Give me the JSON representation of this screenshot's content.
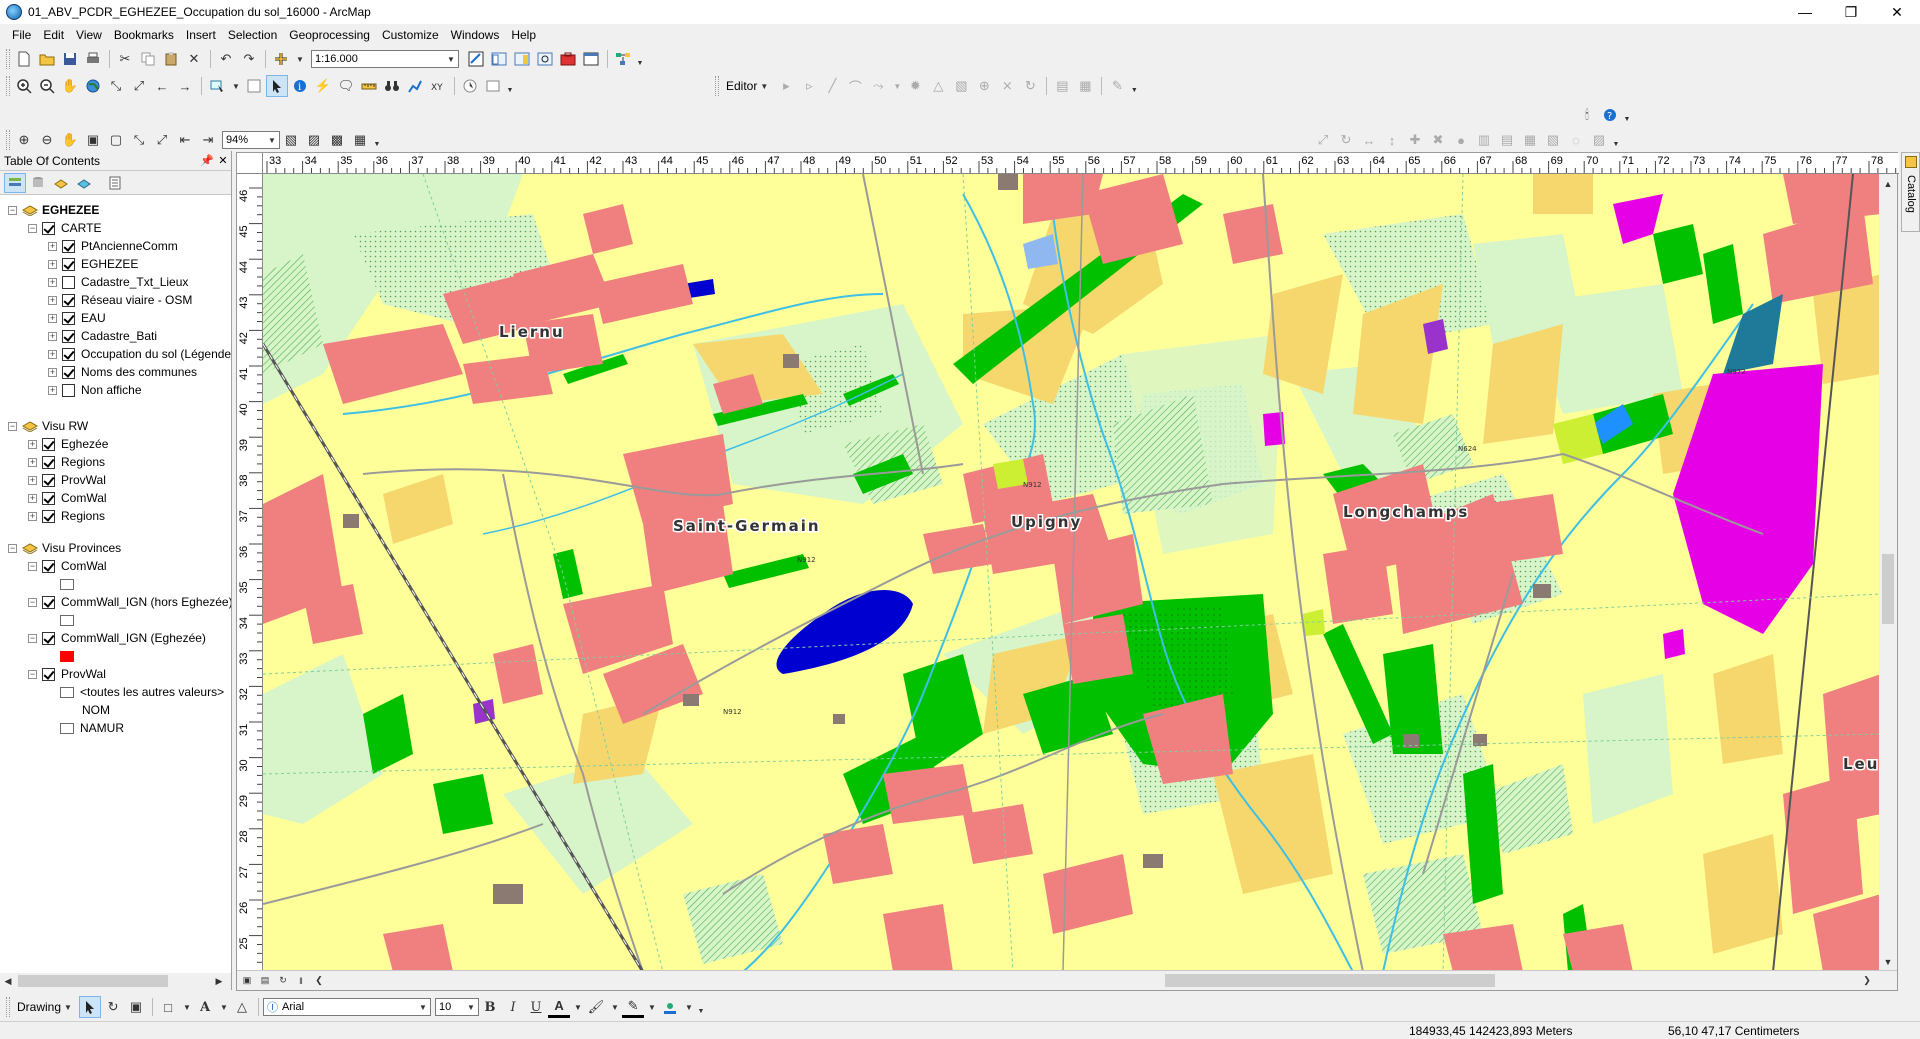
{
  "window": {
    "title": "01_ABV_PCDR_EGHEZEE_Occupation du sol_16000 - ArcMap"
  },
  "menu": [
    "File",
    "Edit",
    "View",
    "Bookmarks",
    "Insert",
    "Selection",
    "Geoprocessing",
    "Customize",
    "Windows",
    "Help"
  ],
  "toolbar": {
    "scale": "1:16.000",
    "editor_label": "Editor",
    "zoom_percent": "94%"
  },
  "toc": {
    "title": "Table Of Contents",
    "groups": [
      {
        "label": "EGHEZEE",
        "bold": true,
        "expanded": true
      },
      {
        "label": "CARTE",
        "checked": true
      },
      {
        "label": "PtAncienneComm",
        "checked": true
      },
      {
        "label": "EGHEZEE",
        "checked": true
      },
      {
        "label": "Cadastre_Txt_Lieux",
        "checked": false
      },
      {
        "label": "Réseau viaire - OSM",
        "checked": true
      },
      {
        "label": "EAU",
        "checked": true
      },
      {
        "label": "Cadastre_Bati",
        "checked": true
      },
      {
        "label": "Occupation du sol (Légende",
        "checked": true
      },
      {
        "label": "Noms des communes",
        "checked": true
      },
      {
        "label": "Non affiche",
        "checked": false
      },
      {
        "label": "Visu RW"
      },
      {
        "label": "Eghezée",
        "checked": true
      },
      {
        "label": "Regions",
        "checked": true
      },
      {
        "label": "ProvWal",
        "checked": true
      },
      {
        "label": "ComWal",
        "checked": true
      },
      {
        "label": "Regions",
        "checked": true
      },
      {
        "label": "Visu Provinces"
      },
      {
        "label": "ComWal",
        "checked": true
      },
      {
        "label": "CommWall_IGN (hors Eghezée)",
        "checked": true
      },
      {
        "label": "CommWall_IGN (Eghezée)",
        "checked": true,
        "swatch": "#ff0000"
      },
      {
        "label": "ProvWal",
        "checked": true
      },
      {
        "label": "<toutes les autres valeurs>"
      },
      {
        "label": "NOM"
      },
      {
        "label": "NAMUR"
      }
    ]
  },
  "ruler_top": [
    "33",
    "34",
    "35",
    "36",
    "37",
    "38",
    "39",
    "40",
    "41",
    "42",
    "43",
    "44",
    "45",
    "46",
    "47",
    "48",
    "49",
    "50",
    "51",
    "52",
    "53",
    "54",
    "55",
    "56",
    "57",
    "58",
    "59",
    "60",
    "61",
    "62",
    "63",
    "64",
    "65",
    "66",
    "67",
    "68",
    "69",
    "70",
    "71",
    "72",
    "73",
    "74",
    "75",
    "76",
    "77",
    "78"
  ],
  "ruler_left": [
    "46",
    "45",
    "44",
    "43",
    "42",
    "41",
    "40",
    "39",
    "38",
    "37",
    "36",
    "35",
    "34",
    "33",
    "32",
    "31",
    "30",
    "29",
    "28",
    "27",
    "26",
    "25"
  ],
  "map": {
    "places": [
      "Liernu",
      "Saint-Germain",
      "Upigny",
      "Longchamps",
      "Leu"
    ],
    "road_labels": [
      "N912",
      "N912",
      "N624",
      "N912",
      "N972"
    ],
    "colors": {
      "agri": "#ffff99",
      "crop": "#f5d76e",
      "built": "#f08080",
      "forest": "#00c000",
      "meadow": "#d7f5c8",
      "water": "#1e90ff",
      "industry": "#e600e6"
    }
  },
  "catalog_tab": "Catalog",
  "drawing": {
    "label": "Drawing",
    "font": "Arial",
    "size": "10"
  },
  "status": {
    "coords": "184933,45  142423,893 Meters",
    "page": "56,10  47,17 Centimeters"
  }
}
